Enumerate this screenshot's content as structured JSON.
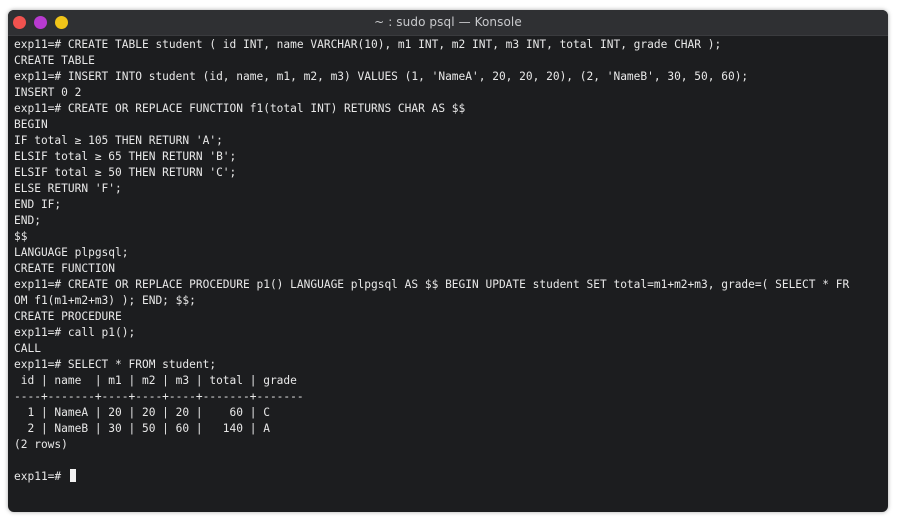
{
  "window": {
    "title": "~ : sudo psql — Konsole",
    "buttons": {
      "close_color": "#f0524f",
      "minimize_color": "#b83ad0",
      "maximize_color": "#f0c419"
    }
  },
  "terminal": {
    "lines": [
      "exp11=# CREATE TABLE student ( id INT, name VARCHAR(10), m1 INT, m2 INT, m3 INT, total INT, grade CHAR );",
      "CREATE TABLE",
      "exp11=# INSERT INTO student (id, name, m1, m2, m3) VALUES (1, 'NameA', 20, 20, 20), (2, 'NameB', 30, 50, 60);",
      "INSERT 0 2",
      "exp11=# CREATE OR REPLACE FUNCTION f1(total INT) RETURNS CHAR AS $$",
      "BEGIN",
      "IF total ≥ 105 THEN RETURN 'A';",
      "ELSIF total ≥ 65 THEN RETURN 'B';",
      "ELSIF total ≥ 50 THEN RETURN 'C';",
      "ELSE RETURN 'F';",
      "END IF;",
      "END;",
      "$$",
      "LANGUAGE plpgsql;",
      "CREATE FUNCTION",
      "exp11=# CREATE OR REPLACE PROCEDURE p1() LANGUAGE plpgsql AS $$ BEGIN UPDATE student SET total=m1+m2+m3, grade=( SELECT * FR",
      "OM f1(m1+m2+m3) ); END; $$;",
      "CREATE PROCEDURE",
      "exp11=# call p1();",
      "CALL",
      "exp11=# SELECT * FROM student;",
      " id | name  | m1 | m2 | m3 | total | grade",
      "----+-------+----+----+----+-------+-------",
      "  1 | NameA | 20 | 20 | 20 |    60 | C",
      "  2 | NameB | 30 | 50 | 60 |   140 | A",
      "(2 rows)",
      ""
    ],
    "prompt": "exp11=#"
  }
}
